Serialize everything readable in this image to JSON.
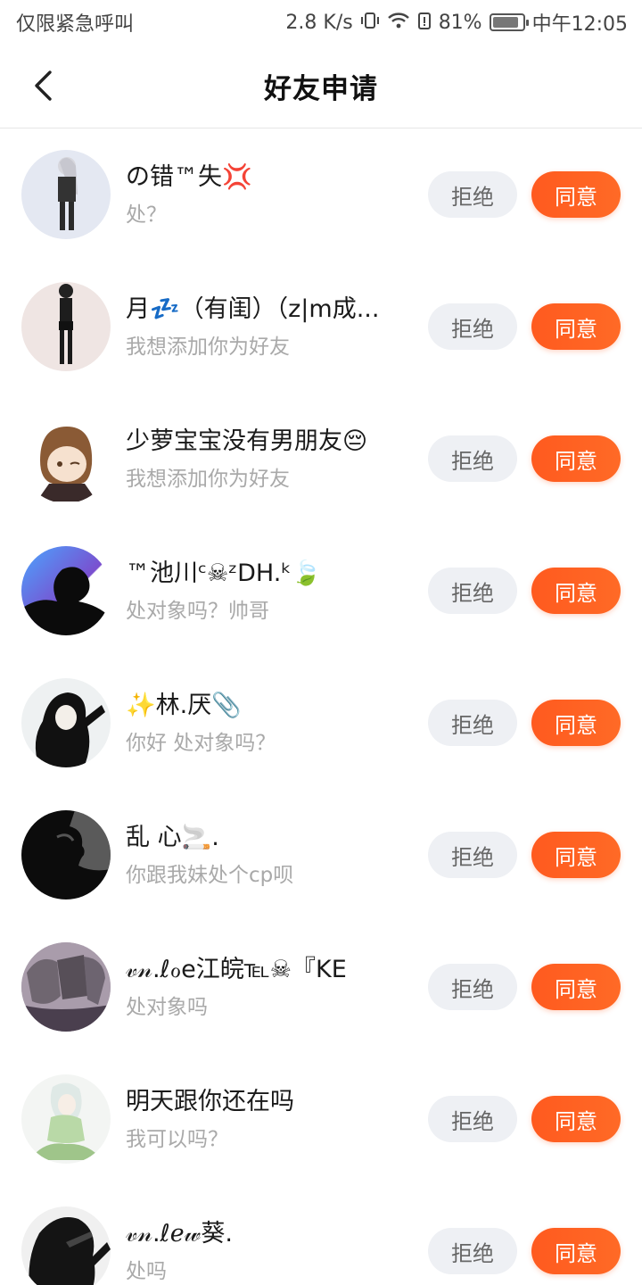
{
  "status_bar": {
    "left_text": "仅限紧急呼叫",
    "network_speed": "2.8 K/s",
    "battery": "81%",
    "time": "中午12:05"
  },
  "header": {
    "title": "好友申请"
  },
  "buttons": {
    "reject_label": "拒绝",
    "accept_label": "同意"
  },
  "requests": [
    {
      "name": "の错™失💢",
      "message": "处？"
    },
    {
      "name": "月💤（有闺）（z|m成...",
      "message": "我想添加你为好友"
    },
    {
      "name": "少萝宝宝没有男朋友😔",
      "message": "我想添加你为好友"
    },
    {
      "name": "™池川ᶜ☠ᶻDH.ᵏ🍃",
      "message": "处对象吗？帅哥"
    },
    {
      "name": "✨林.厌📎",
      "message": "你好 处对象吗？"
    },
    {
      "name": "乱 心🚬.",
      "message": "你跟我妹处个cp呗"
    },
    {
      "name": "𝓋𝓃.ℓℴe江皖℡☠『KE",
      "message": "处对象吗"
    },
    {
      "name": "明天跟你还在吗",
      "message": "我可以吗？"
    },
    {
      "name": "𝓋𝓃.ℓℯ𝓌葵.",
      "message": "处吗"
    }
  ],
  "colors": {
    "accent": "#ff5a1f",
    "reject_bg": "#eef0f4"
  }
}
